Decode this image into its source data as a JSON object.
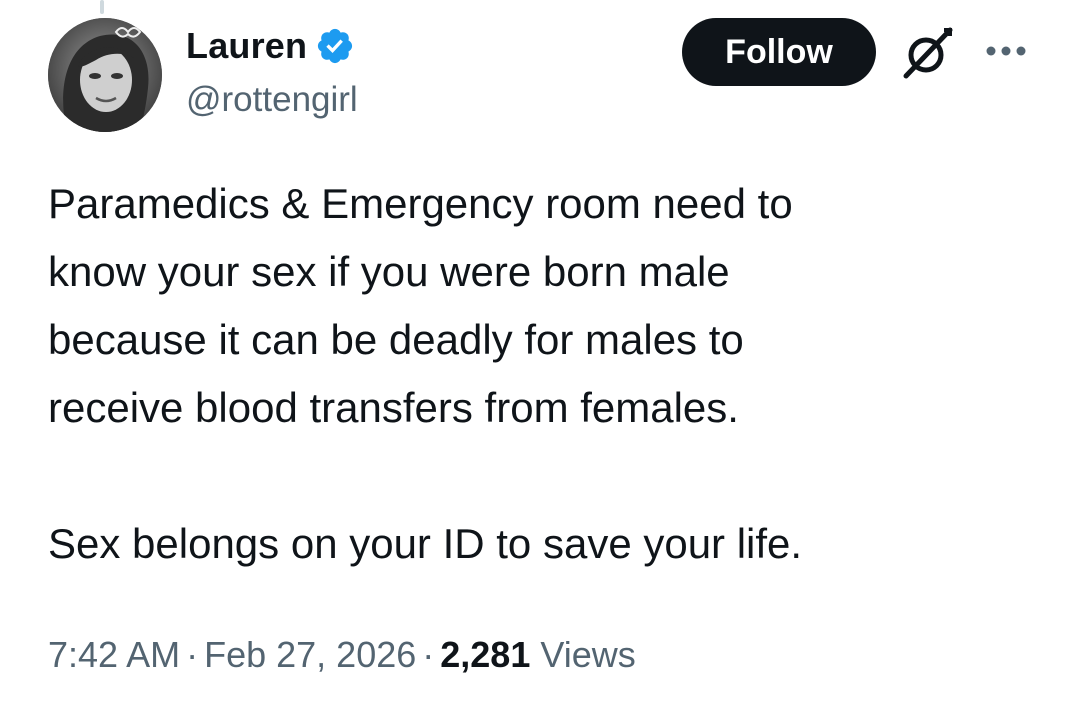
{
  "author": {
    "display_name": "Lauren",
    "handle": "@rottengirl",
    "verified": true,
    "verified_color": "#1d9bf0"
  },
  "actions": {
    "follow_label": "Follow",
    "grok_icon": "grok-icon",
    "more_icon": "more-icon"
  },
  "tweet": {
    "text": "Paramedics & Emergency room need to\nknow your sex if you were born male\nbecause it can be deadly for males to\nreceive blood transfers from females.\n\nSex belongs on your ID to save your life."
  },
  "meta": {
    "time": "7:42 AM",
    "separator": "·",
    "date": "Feb 27, 2026",
    "views_count": "2,281",
    "views_label": "Views"
  },
  "colors": {
    "text_primary": "#0f1419",
    "text_secondary": "#536471",
    "button_bg": "#0f1419",
    "button_text": "#ffffff"
  }
}
